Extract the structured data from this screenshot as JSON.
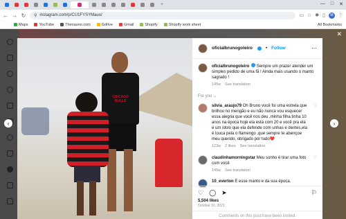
{
  "browser": {
    "url": "instagram.com/p/CU1FYSYMauo/",
    "bookmarks": [
      "Maps",
      "YouTube",
      "Theoauno.com",
      "Gdrive",
      "Gmail",
      "Shopify",
      "Shopify work sheet"
    ],
    "all_bookmarks": "All Bookmarks",
    "profile_initial": "M"
  },
  "post": {
    "username": "oficialbrunogoleiro",
    "follow_label": "Follow",
    "caption": "Sempre um prazer atender um simples pedido de uma fã ! Ainda mais usando o manto sagrado !",
    "caption_age": "145w",
    "see_translation": "See translation",
    "for_you": "For you",
    "shirt_text": "CHICAGO BULLS",
    "comments": [
      {
        "user": "silvia_araujo79",
        "text": "Oh Bruno você foi uma estrela que brilhou no mengão e eu não nunca vou esquecer essa alegria que você nos deu ,minha filha tinha 10 anos na época hoje ela está com 20 e você pra ela é um ídolo que ela defende com unhas e dentes,ela é louca pela o flamengo ,que sempre te abençoe meu querido, obrigado por tudo❤️",
        "age": "123w",
        "likes": "2 likes",
        "action": "See translation"
      },
      {
        "user": "claudinhamorningstar",
        "text": "Meu sonho é tirar uma foto com você",
        "age": "145w",
        "likes": "",
        "action": "See translation"
      },
      {
        "user": "10_everton",
        "text": "E esse manto e da sua época.",
        "age": "",
        "likes": "",
        "action": ""
      }
    ],
    "likes": "5,504 likes",
    "date": "October 10, 2021",
    "limited": "Comments on this post have been limited."
  }
}
